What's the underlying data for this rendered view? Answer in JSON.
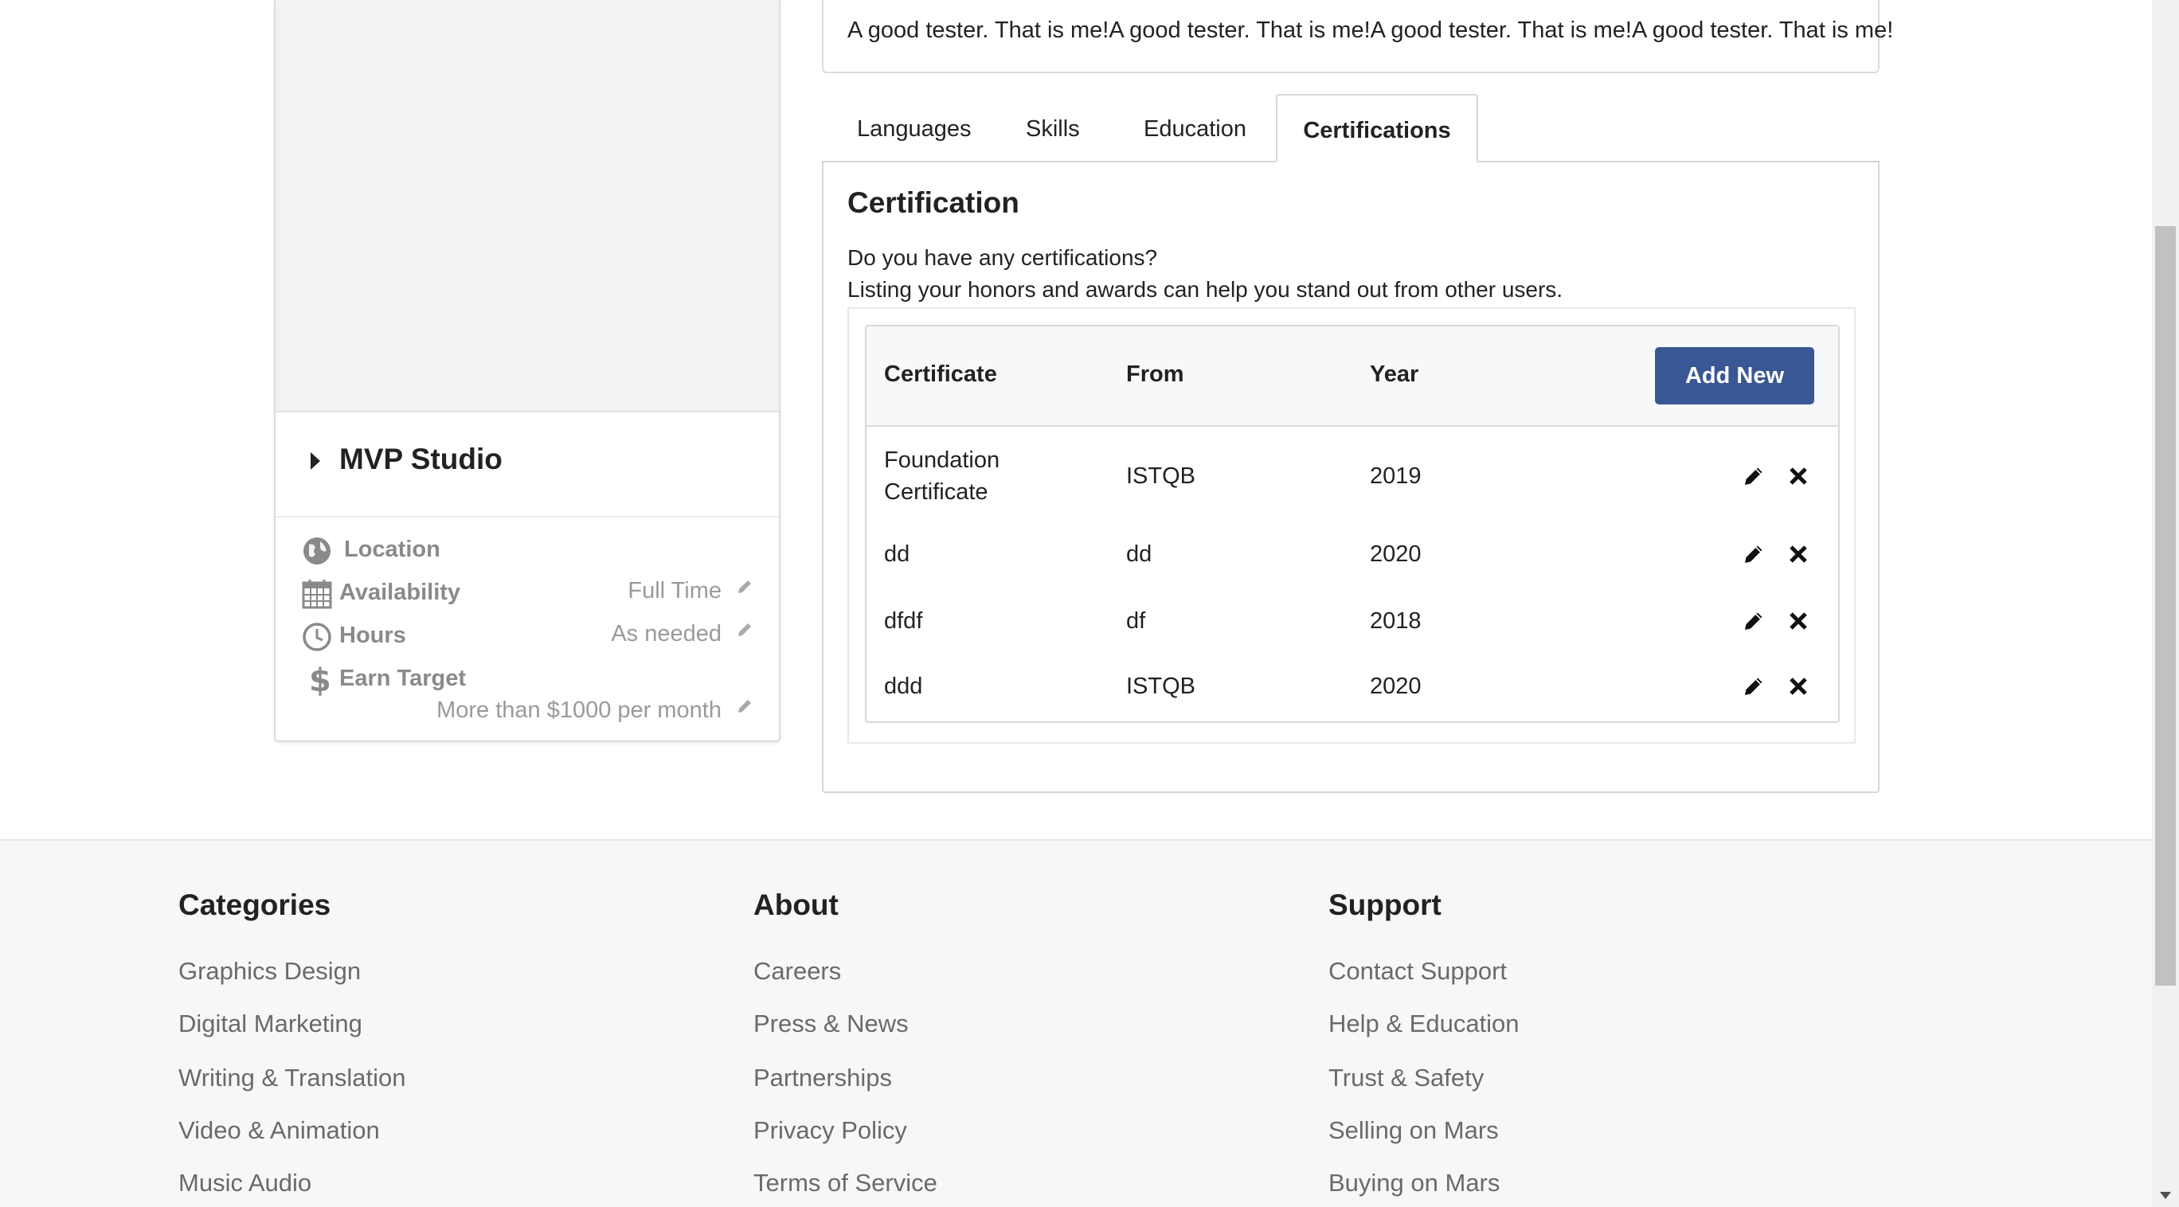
{
  "description": "A good tester. That is me!A good tester. That is me!A good tester. That is me!A good tester. That is me!",
  "profile": {
    "studio_name": "MVP Studio",
    "location_label": "Location",
    "availability_label": "Availability",
    "availability_value": "Full Time",
    "hours_label": "Hours",
    "hours_value": "As needed",
    "earn_label": "Earn Target",
    "earn_value": "More than $1000 per month"
  },
  "tabs": [
    {
      "label": "Languages"
    },
    {
      "label": "Skills"
    },
    {
      "label": "Education"
    },
    {
      "label": "Certifications",
      "active": true
    }
  ],
  "certification": {
    "title": "Certification",
    "question": "Do you have any certifications?",
    "hint": "Listing your honors and awards can help you stand out from other users.",
    "headers": {
      "certificate": "Certificate",
      "from": "From",
      "year": "Year"
    },
    "add_button": "Add New",
    "rows": [
      {
        "certificate_line1": "Foundation",
        "certificate_line2": "Certificate",
        "from": "ISTQB",
        "year": "2019"
      },
      {
        "certificate_line1": "dd",
        "certificate_line2": "",
        "from": "dd",
        "year": "2020"
      },
      {
        "certificate_line1": "dfdf",
        "certificate_line2": "",
        "from": "df",
        "year": "2018"
      },
      {
        "certificate_line1": "ddd",
        "certificate_line2": "",
        "from": "ISTQB",
        "year": "2020"
      }
    ]
  },
  "footer": {
    "categories": {
      "title": "Categories",
      "links": [
        "Graphics Design",
        "Digital Marketing",
        "Writing & Translation",
        "Video & Animation",
        "Music Audio"
      ]
    },
    "about": {
      "title": "About",
      "links": [
        "Careers",
        "Press & News",
        "Partnerships",
        "Privacy Policy",
        "Terms of Service"
      ]
    },
    "support": {
      "title": "Support",
      "links": [
        "Contact Support",
        "Help & Education",
        "Trust & Safety",
        "Selling on Mars",
        "Buying on Mars"
      ]
    }
  },
  "icons": {
    "location": "globe-icon",
    "availability": "calendar-icon",
    "hours": "clock-icon",
    "earn": "dollar-icon",
    "edit": "pencil-icon",
    "delete": "close-icon"
  },
  "colors": {
    "primary_button": "#3a5795",
    "muted_text": "#8a8a8a",
    "footer_bg": "#f7f7f7"
  }
}
